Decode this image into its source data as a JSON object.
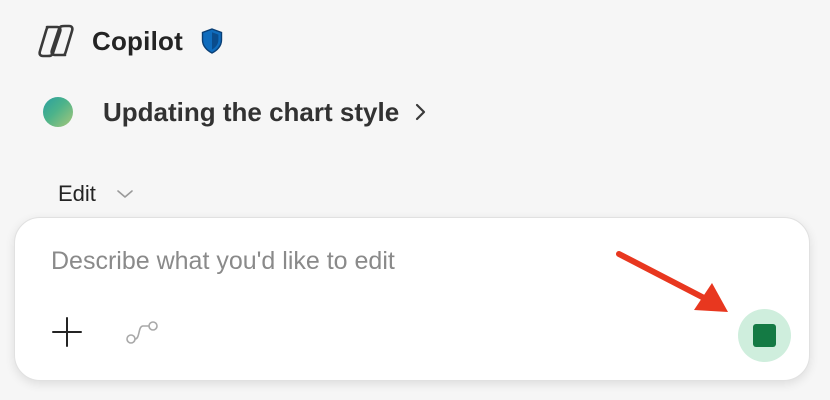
{
  "header": {
    "app_title": "Copilot",
    "logo_icon": "copilot-logo-icon",
    "badge_icon": "shield-icon",
    "badge_color": "#0f6cbd"
  },
  "conversation": {
    "title": "Updating the chart style",
    "avatar_icon": "gradient-orb-icon",
    "chevron_icon": "chevron-right-icon"
  },
  "mode": {
    "label": "Edit",
    "chevron_icon": "chevron-down-icon"
  },
  "composer": {
    "placeholder": "Describe what you'd like to edit",
    "value": "",
    "add_icon": "plus-icon",
    "connect_icon": "connector-icon",
    "stop_icon": "stop-icon",
    "stop_button_bg": "#cfeedd",
    "stop_color": "#147a44"
  },
  "annotation": {
    "arrow_icon": "red-arrow-icon",
    "arrow_color": "#e8371f"
  }
}
